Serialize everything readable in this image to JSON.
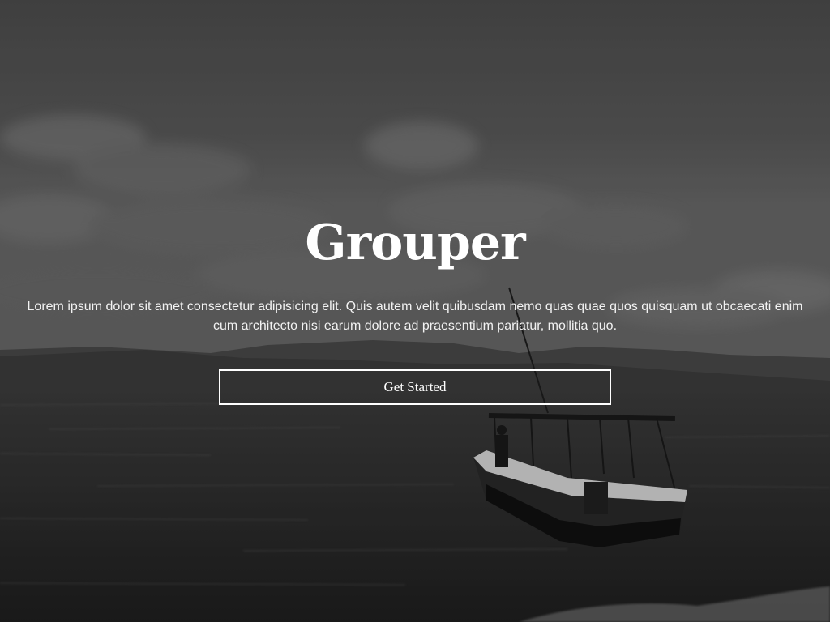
{
  "hero": {
    "title": "Grouper",
    "description": "Lorem ipsum dolor sit amet consectetur adipisicing elit. Quis autem velit quibusdam nemo quas quae quos quisquam ut obcaecati enim cum architecto nisi earum dolore ad praesentium pariatur, mollitia quo.",
    "cta_label": "Get Started"
  },
  "colors": {
    "text": "#ffffff",
    "button_border": "#ffffff"
  }
}
